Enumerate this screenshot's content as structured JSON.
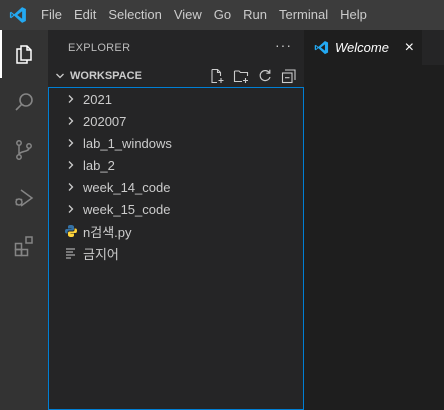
{
  "menu": [
    "File",
    "Edit",
    "Selection",
    "View",
    "Go",
    "Run",
    "Terminal",
    "Help"
  ],
  "activity_bar": [
    "explorer-icon",
    "search-icon",
    "source-control-icon",
    "run-debug-icon",
    "extensions-icon"
  ],
  "sidebar": {
    "title": "EXPLORER",
    "more": "···",
    "section": "WORKSPACE",
    "items": [
      {
        "label": "2021",
        "type": "folder"
      },
      {
        "label": "202007",
        "type": "folder"
      },
      {
        "label": "lab_1_windows",
        "type": "folder"
      },
      {
        "label": "lab_2",
        "type": "folder"
      },
      {
        "label": "week_14_code",
        "type": "folder"
      },
      {
        "label": "week_15_code",
        "type": "folder"
      },
      {
        "label": "n검색.py",
        "type": "python-file"
      },
      {
        "label": "금지어",
        "type": "text-file"
      }
    ]
  },
  "editor": {
    "tab_label": "Welcome",
    "close": "×"
  },
  "colors": {
    "titlebar": "#3c3c3c",
    "activitybar": "#333333",
    "sidebar": "#252526",
    "editor": "#1e1e1e",
    "focus_border": "#007fd4",
    "vscode_blue": "#23a9f2"
  }
}
